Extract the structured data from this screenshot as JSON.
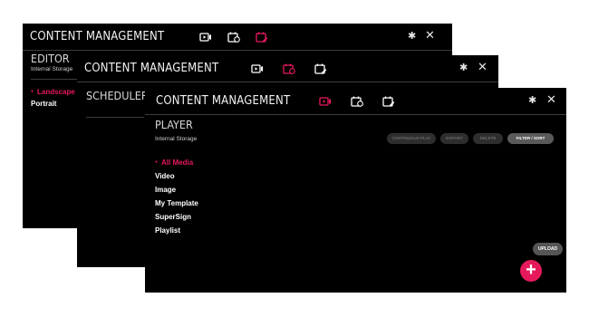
{
  "colors": {
    "accent": "#e6195a",
    "background": "#000000"
  },
  "windows": {
    "editor": {
      "app_title": "CONTENT MANAGEMENT",
      "section_title": "EDITOR",
      "subtitle": "Internal Storage",
      "menu": [
        {
          "label": "Landscape",
          "active": true
        },
        {
          "label": "Portrait",
          "active": false
        }
      ],
      "icons": [
        "player-icon",
        "scheduler-icon",
        "editor-icon"
      ],
      "active_icon": "editor-icon"
    },
    "scheduler": {
      "app_title": "CONTENT MANAGEMENT",
      "section_title": "SCHEDULER",
      "icons": [
        "player-icon",
        "scheduler-icon",
        "editor-icon"
      ],
      "active_icon": "scheduler-icon"
    },
    "player": {
      "app_title": "CONTENT MANAGEMENT",
      "section_title": "PLAYER",
      "subtitle": "Internal Storage",
      "icons": [
        "player-icon",
        "scheduler-icon",
        "editor-icon"
      ],
      "active_icon": "player-icon",
      "menu": [
        {
          "label": "All Media",
          "active": true
        },
        {
          "label": "Video",
          "active": false
        },
        {
          "label": "Image",
          "active": false
        },
        {
          "label": "My Template",
          "active": false
        },
        {
          "label": "SuperSign",
          "active": false
        },
        {
          "label": "Playlist",
          "active": false
        }
      ],
      "actions": [
        {
          "label": "CONTINUOUS PLAY",
          "enabled": false
        },
        {
          "label": "EXPORT",
          "enabled": false
        },
        {
          "label": "DELETE",
          "enabled": false
        },
        {
          "label": "FILTER / SORT",
          "enabled": true
        }
      ],
      "upload_tooltip": "UPLOAD",
      "fab_icon": "plus-icon"
    }
  }
}
